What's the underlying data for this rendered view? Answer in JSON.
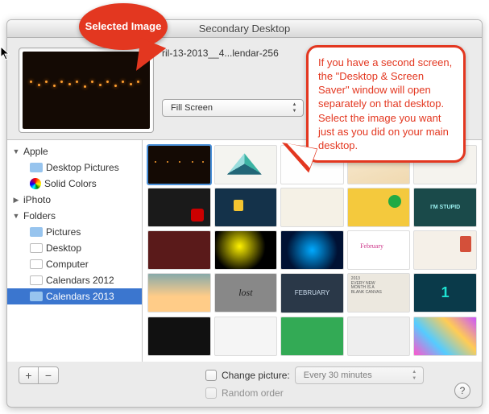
{
  "window": {
    "title": "Secondary Desktop"
  },
  "callouts": {
    "selected_image": "Selected Image",
    "help_text": "If you have a second screen, the \"Desktop & Screen Saver\" window will open separately on that desktop. Select the image you want just as you did on your main desktop."
  },
  "preview": {
    "filename": "ril-13-2013__4...lendar-256",
    "fit_mode": "Fill Screen"
  },
  "sidebar": {
    "groups": [
      {
        "label": "Apple",
        "expanded": true,
        "children": [
          {
            "label": "Desktop Pictures",
            "icon": "folder-blue"
          },
          {
            "label": "Solid Colors",
            "icon": "colorwheel"
          }
        ]
      },
      {
        "label": "iPhoto",
        "expanded": false,
        "children": []
      },
      {
        "label": "Folders",
        "expanded": true,
        "children": [
          {
            "label": "Pictures",
            "icon": "folder-blue"
          },
          {
            "label": "Desktop",
            "icon": "folder-white"
          },
          {
            "label": "Computer",
            "icon": "folder-white"
          },
          {
            "label": "Calendars 2012",
            "icon": "folder-white"
          },
          {
            "label": "Calendars 2013",
            "icon": "folder-blue",
            "selected": true
          }
        ]
      }
    ]
  },
  "footer": {
    "change_picture_label": "Change picture:",
    "interval": "Every 30 minutes",
    "random_label": "Random order"
  },
  "buttons": {
    "add": "+",
    "remove": "−",
    "help": "?"
  }
}
